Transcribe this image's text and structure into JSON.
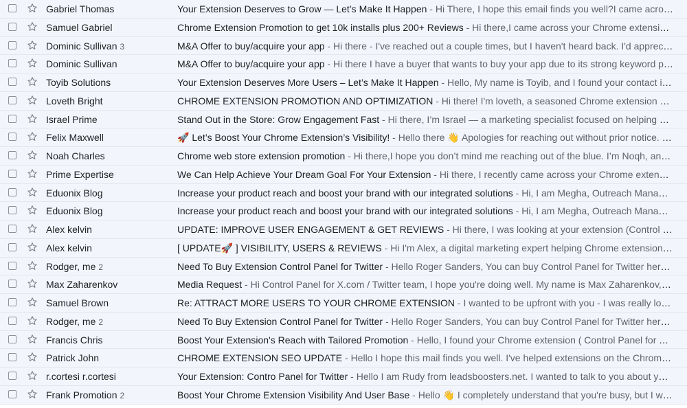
{
  "inbox": {
    "separator": " - ",
    "rows": [
      {
        "sender": "Gabriel Thomas",
        "count": "",
        "subject": "Your Extension Deserves to Grow — Let’s Make It Happen",
        "snippet": "Hi There, I hope this email finds you well?I came across your Chrome extension"
      },
      {
        "sender": "Samuel Gabriel",
        "count": "",
        "subject": "Chrome Extension Promotion to get 10k installs plus 200+ Reviews",
        "snippet": "Hi there,I came across your Chrome extension:-"
      },
      {
        "sender": "Dominic Sullivan",
        "count": "3",
        "subject": "M&A Offer to buy/acquire your app",
        "snippet": "Hi there - I've reached out a couple times, but I haven't heard back. I'd appreciate a reply"
      },
      {
        "sender": "Dominic Sullivan",
        "count": "",
        "subject": "M&A Offer to buy/acquire your app",
        "snippet": "Hi there I have a buyer that wants to buy your app due to its strong keyword position"
      },
      {
        "sender": "Toyib Solutions",
        "count": "",
        "subject": "Your Extension Deserves More Users – Let’s Make It Happen",
        "snippet": "Hello, My name is Toyib, and I found your contact information"
      },
      {
        "sender": "Loveth Bright",
        "count": "",
        "subject": "CHROME EXTENSION PROMOTION AND OPTIMIZATION",
        "snippet": "Hi there! I'm loveth, a seasoned Chrome extension promotion specialist"
      },
      {
        "sender": "Israel Prime",
        "count": "",
        "subject": "Stand Out in the Store: Grow Engagement Fast",
        "snippet": "Hi there, I’m Israel — a marketing specialist focused on helping Chrome extensions"
      },
      {
        "sender": "Felix Maxwell",
        "count": "",
        "subject": "🚀 Let’s Boost Your Chrome Extension’s Visibility!",
        "snippet": "Hello there 👋 Apologies for reaching out without prior notice. My name is Felix"
      },
      {
        "sender": "Noah Charles",
        "count": "",
        "subject": "Chrome web store extension promotion",
        "snippet": "Hi there,I hope you don’t mind me reaching out of the blue. I’m Noqh, and I am"
      },
      {
        "sender": "Prime Expertise",
        "count": "",
        "subject": "We Can Help Achieve Your Dream Goal For Your Extension",
        "snippet": "Hi there, I recently came across your Chrome extension (Control Panel for Twitter)"
      },
      {
        "sender": "Eduonix Blog",
        "count": "",
        "subject": "Increase your product reach and boost your brand with our integrated solutions",
        "snippet": "Hi, I am Megha, Outreach Manager at Eduonix"
      },
      {
        "sender": "Eduonix Blog",
        "count": "",
        "subject": "Increase your product reach and boost your brand with our integrated solutions",
        "snippet": "Hi, I am Megha, Outreach Manager at Eduonix"
      },
      {
        "sender": "Alex kelvin",
        "count": "",
        "subject": "UPDATE: IMPROVE USER ENGAGEMENT & GET REVIEWS",
        "snippet": "Hi there, I was looking at your extension (Control Panel for Twitter)"
      },
      {
        "sender": "Alex kelvin",
        "count": "",
        "subject": "[ UPDATE🚀 ] VISIBILITY, USERS & REVIEWS",
        "snippet": "Hi I'm Alex, a digital marketing expert helping Chrome extensions like yours"
      },
      {
        "sender": "Rodger, me",
        "count": "2",
        "subject": "Need To Buy Extension Control Panel for Twitter",
        "snippet": "Hello Roger Sanders, You can buy Control Panel for Twitter here, it is"
      },
      {
        "sender": "Max Zaharenkov",
        "count": "",
        "subject": "Media Request",
        "snippet": "Hi Control Panel for X.com / Twitter team, I hope you're doing well. My name is Max Zaharenkov, and I"
      },
      {
        "sender": "Samuel Brown",
        "count": "",
        "subject": "Re: ATTRACT MORE USERS TO YOUR CHROME EXTENSION",
        "snippet": "I wanted to be upfront with you - I was really looking forward"
      },
      {
        "sender": "Rodger, me",
        "count": "2",
        "subject": "Need To Buy Extension Control Panel for Twitter",
        "snippet": "Hello Roger Sanders, You can buy Control Panel for Twitter here, it is"
      },
      {
        "sender": "Francis Chris",
        "count": "",
        "subject": "Boost Your Extension's Reach with Tailored Promotion",
        "snippet": "Hello, I found your Chrome extension ( Control Panel for YouTube"
      },
      {
        "sender": "Patrick John",
        "count": "",
        "subject": "CHROME EXTENSION SEO UPDATE",
        "snippet": "Hello I hope this mail finds you well. I've helped extensions on the Chrome web store"
      },
      {
        "sender": "r.cortesi r.cortesi",
        "count": "",
        "subject": "Your Extension: Contro Panel for Twitter",
        "snippet": "Hello I am Rudy from leadsboosters.net. I wanted to talk to you about your extension"
      },
      {
        "sender": "Frank Promotion",
        "count": "2",
        "subject": "Boost Your Chrome Extension Visibility And User Base",
        "snippet": "Hello 👋 I completely understand that you're busy, but I want to"
      }
    ]
  }
}
